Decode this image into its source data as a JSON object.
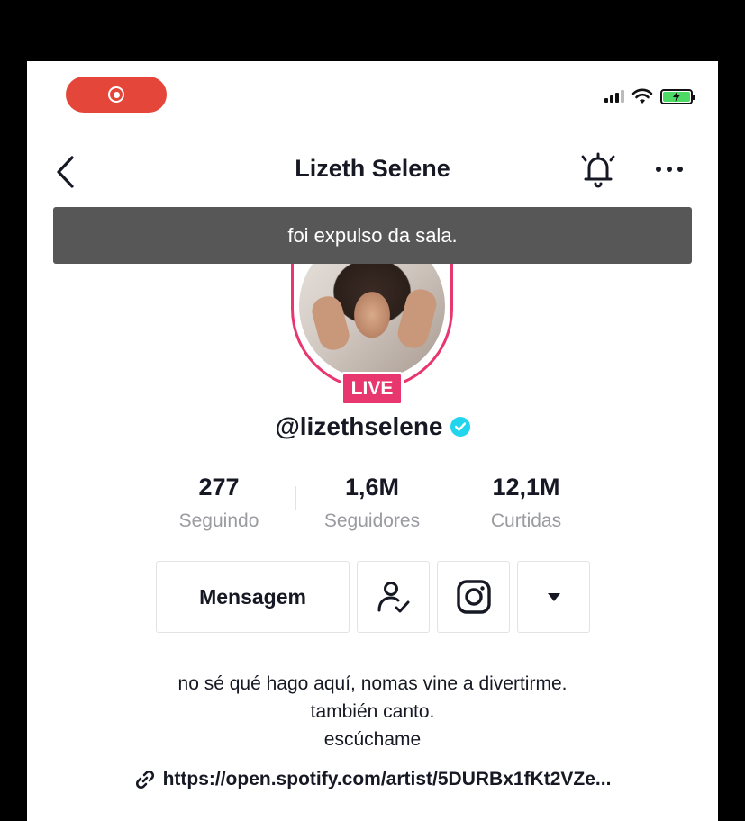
{
  "status_bar": {
    "recording_icon": "record-icon",
    "signal_icon": "cellular-signal-icon",
    "wifi_icon": "wifi-icon",
    "battery_icon": "battery-charging-icon"
  },
  "header": {
    "title": "Lizeth Selene",
    "back_icon": "chevron-left-icon",
    "bell_icon": "bell-icon",
    "more_icon": "more-horizontal-icon"
  },
  "toast": {
    "message": "foi expulso da sala."
  },
  "profile": {
    "live_label": "LIVE",
    "username": "@lizethselene",
    "verified_icon": "verified-badge-icon"
  },
  "stats": [
    {
      "value": "277",
      "label": "Seguindo"
    },
    {
      "value": "1,6M",
      "label": "Seguidores"
    },
    {
      "value": "12,1M",
      "label": "Curtidas"
    }
  ],
  "actions": {
    "message_label": "Mensagem",
    "follow_icon": "user-check-icon",
    "instagram_icon": "instagram-icon",
    "dropdown_icon": "caret-down-icon"
  },
  "bio": {
    "line1": "no sé qué hago aquí, nomas vine a divertirme.",
    "line2": "también canto.",
    "line3": "escúchame",
    "link": "https://open.spotify.com/artist/5DURBx1fKt2VZe..."
  },
  "colors": {
    "accent": "#e8376f",
    "record": "#e5463a",
    "verified": "#20d5ec",
    "toast_bg": "#575757"
  }
}
